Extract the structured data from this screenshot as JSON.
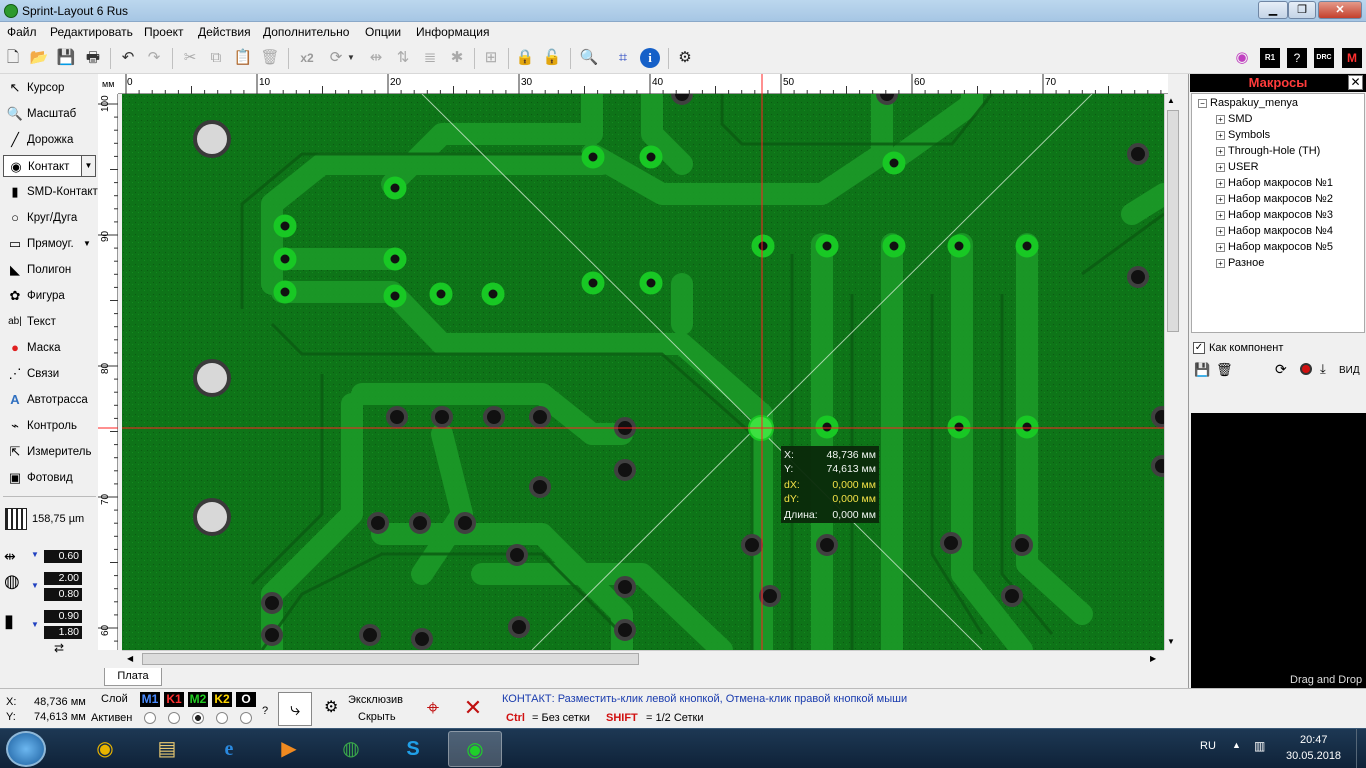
{
  "window": {
    "title": "Sprint-Layout 6 Rus",
    "min": "▁",
    "max": "❐",
    "close": "✕"
  },
  "menu": [
    "Файл",
    "Редактировать",
    "Проект",
    "Действия",
    "Дополнительно",
    "Опции",
    "Информация"
  ],
  "toolbar": {
    "x2": "x2"
  },
  "tools": [
    {
      "label": "Курсор",
      "icon": "cursor-icon",
      "glyph": "↖"
    },
    {
      "label": "Масштаб",
      "icon": "zoom-icon",
      "glyph": "🔍"
    },
    {
      "label": "Дорожка",
      "icon": "track-icon",
      "glyph": "╱"
    },
    {
      "label": "Контакт",
      "icon": "pad-icon",
      "glyph": "◉"
    },
    {
      "label": "SMD-Контакт",
      "icon": "smd-pad-icon",
      "glyph": "▮"
    },
    {
      "label": "Круг/Дуга",
      "icon": "circle-icon",
      "glyph": "○"
    },
    {
      "label": "Прямоуг.",
      "icon": "rectangle-icon",
      "glyph": "▭"
    },
    {
      "label": "Полигон",
      "icon": "polygon-icon",
      "glyph": "◣"
    },
    {
      "label": "Фигура",
      "icon": "figure-icon",
      "glyph": "✿"
    },
    {
      "label": "Текст",
      "icon": "text-icon",
      "glyph": "ab|"
    },
    {
      "label": "Маска",
      "icon": "mask-icon",
      "glyph": "●"
    },
    {
      "label": "Связи",
      "icon": "connections-icon",
      "glyph": "⋰"
    },
    {
      "label": "Автотрасса",
      "icon": "autoroute-icon",
      "glyph": "A"
    },
    {
      "label": "Контроль",
      "icon": "control-icon",
      "glyph": "⌁"
    },
    {
      "label": "Измеритель",
      "icon": "measure-icon",
      "glyph": "⇱"
    },
    {
      "label": "Фотовид",
      "icon": "photoview-icon",
      "glyph": "▣"
    }
  ],
  "grid": {
    "value": "158,75 µm"
  },
  "track_width": "0.60",
  "pad_outer": "2.00",
  "pad_inner": "0.80",
  "smd_w": "0.90",
  "smd_h": "1.80",
  "ruler": {
    "unit": "мм",
    "top_ticks": [
      "0",
      "10",
      "20",
      "30",
      "40",
      "50",
      "60",
      "70"
    ],
    "left_ticks": [
      "100",
      "90",
      "80",
      "70",
      "60"
    ]
  },
  "readout": {
    "x_label": "X:",
    "x": "48,736 мм",
    "y_label": "Y:",
    "y": "74,613 мм",
    "dx_label": "dX:",
    "dx": "0,000 мм",
    "dy_label": "dY:",
    "dy": "0,000 мм",
    "len_label": "Длина:",
    "len": "0,000 мм"
  },
  "tab": "Плата",
  "macros": {
    "title": "Макросы",
    "root": "Raspakuy_menya",
    "items": [
      "SMD",
      "Symbols",
      "Through-Hole (TH)",
      "USER",
      "Набор макросов №1",
      "Набор макросов №2",
      "Набор макросов №3",
      "Набор макросов №4",
      "Набор макросов №5",
      "Разное"
    ],
    "as_component": "Как компонент",
    "view": "ВИД",
    "drag_drop": "Drag and Drop"
  },
  "status": {
    "x_label": "X:",
    "x": "48,736 мм",
    "y_label": "Y:",
    "y": "74,613 мм",
    "layer_label": "Слой",
    "active_label": "Активен",
    "layers": [
      {
        "name": "M1",
        "color": "#4a8cff"
      },
      {
        "name": "K1",
        "color": "#ff3030"
      },
      {
        "name": "M2",
        "color": "#22cc22"
      },
      {
        "name": "K2",
        "color": "#ffd700"
      },
      {
        "name": "O",
        "color": "#ffffff"
      }
    ],
    "question": "?",
    "exclusive": "Эксклюзив",
    "hide": "Скрыть",
    "hint": "КОНТАКТ:  Разместить-клик левой кнопкой, Отмена-клик правой кнопкой мыши",
    "ctrl_key": "Ctrl",
    "ctrl_text": "= Без сетки",
    "shift_key": "SHIFT",
    "shift_text": "= 1/2 Сетки"
  },
  "taskbar": {
    "lang": "RU",
    "time": "20:47",
    "date": "30.05.2018"
  },
  "colors": {
    "board": "#0f7a18",
    "copper": "#1f9a2a",
    "pad": "#18c824",
    "crosshair": "#ff2020"
  }
}
